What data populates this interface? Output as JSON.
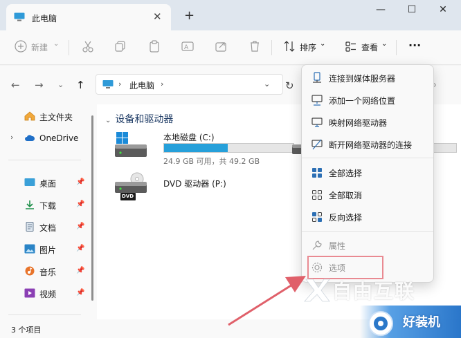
{
  "window": {
    "tab_title": "此电脑",
    "new_tab": "+",
    "tab_close": "✕",
    "controls": {
      "minimize": "—",
      "maximize": "☐",
      "close": "✕"
    }
  },
  "toolbar": {
    "new_label": "新建",
    "sort_label": "排序",
    "view_label": "查看",
    "more_label": "···"
  },
  "address": {
    "path": "此电脑",
    "sep": "›"
  },
  "nav": {
    "home": "主文件夹",
    "onedrive": "OneDrive",
    "pinned": [
      {
        "label": "桌面"
      },
      {
        "label": "下载"
      },
      {
        "label": "文档"
      },
      {
        "label": "图片"
      },
      {
        "label": "音乐"
      },
      {
        "label": "视频"
      }
    ]
  },
  "content": {
    "section_title": "设备和驱动器",
    "drives": [
      {
        "name": "本地磁盘 (C:)",
        "free_text": "24.9 GB 可用，共 49.2 GB",
        "used_fraction": 0.49
      },
      {
        "name": "DVD 驱动器 (P:)",
        "badge": "DVD"
      }
    ]
  },
  "status": {
    "items": "3 个项目"
  },
  "menu": {
    "items": [
      {
        "label": "连接到媒体服务器",
        "icon": "media-server-icon"
      },
      {
        "label": "添加一个网络位置",
        "icon": "network-location-icon"
      },
      {
        "label": "映射网络驱动器",
        "icon": "map-drive-icon"
      },
      {
        "label": "断开网络驱动器的连接",
        "icon": "disconnect-drive-icon"
      },
      {
        "label": "全部选择",
        "icon": "select-all-icon"
      },
      {
        "label": "全部取消",
        "icon": "select-none-icon"
      },
      {
        "label": "反向选择",
        "icon": "invert-selection-icon"
      },
      {
        "label": "属性",
        "icon": "properties-icon",
        "disabled": true
      },
      {
        "label": "选项",
        "icon": "options-gear-icon",
        "disabled": true
      }
    ]
  },
  "watermark": {
    "text": "自由互联",
    "brand": "好装机"
  },
  "colors": {
    "accent": "#26a0da",
    "highlight_box": "#e98a92",
    "arrow": "#e0606a"
  }
}
